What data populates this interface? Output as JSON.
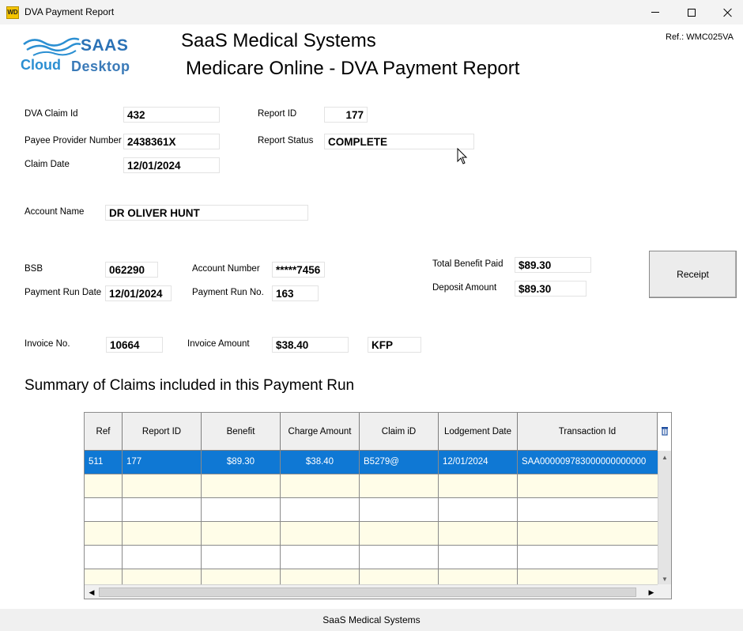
{
  "window": {
    "title": "DVA Payment Report",
    "icon_label": "WD"
  },
  "logo": {
    "top": "SAAS",
    "cloud": "Cloud",
    "desktop": "Desktop"
  },
  "header": {
    "title": "SaaS Medical Systems",
    "subtitle": "Medicare Online - DVA Payment Report",
    "ref": "Ref.: WMC025VA"
  },
  "claim": {
    "dva_claim_id_label": "DVA Claim Id",
    "dva_claim_id": "432",
    "payee_provider_label": "Payee Provider Number",
    "payee_provider": "2438361X",
    "claim_date_label": "Claim Date",
    "claim_date": "12/01/2024",
    "report_id_label": "Report ID",
    "report_id": "177",
    "report_status_label": "Report Status",
    "report_status": "COMPLETE"
  },
  "account": {
    "name_label": "Account Name",
    "name": "DR OLIVER HUNT"
  },
  "payment": {
    "bsb_label": "BSB",
    "bsb": "062290",
    "account_number_label": "Account Number",
    "account_number": "*****7456",
    "run_date_label": "Payment Run Date",
    "run_date": "12/01/2024",
    "run_no_label": "Payment Run No.",
    "run_no": "163",
    "total_benefit_label": "Total Benefit Paid",
    "total_benefit": "$89.30",
    "deposit_amount_label": "Deposit Amount",
    "deposit_amount": "$89.30",
    "receipt_button": "Receipt"
  },
  "invoice": {
    "no_label": "Invoice No.",
    "no": "10664",
    "amount_label": "Invoice Amount",
    "amount": "$38.40",
    "code": "KFP"
  },
  "summary": {
    "title": "Summary of Claims included in this Payment Run",
    "columns": [
      "Ref",
      "Report ID",
      "Benefit",
      "Charge Amount",
      "Claim iD",
      "Lodgement Date",
      "Transaction Id"
    ],
    "rows": [
      [
        "511",
        "177",
        "$89.30",
        "$38.40",
        "B5279@",
        "12/01/2024",
        "SAA000009783000000000000"
      ]
    ],
    "selected_row_color": "#0f78d4",
    "empty_row_color": "#fffde8"
  },
  "status_bar": {
    "text": "SaaS Medical Systems"
  }
}
